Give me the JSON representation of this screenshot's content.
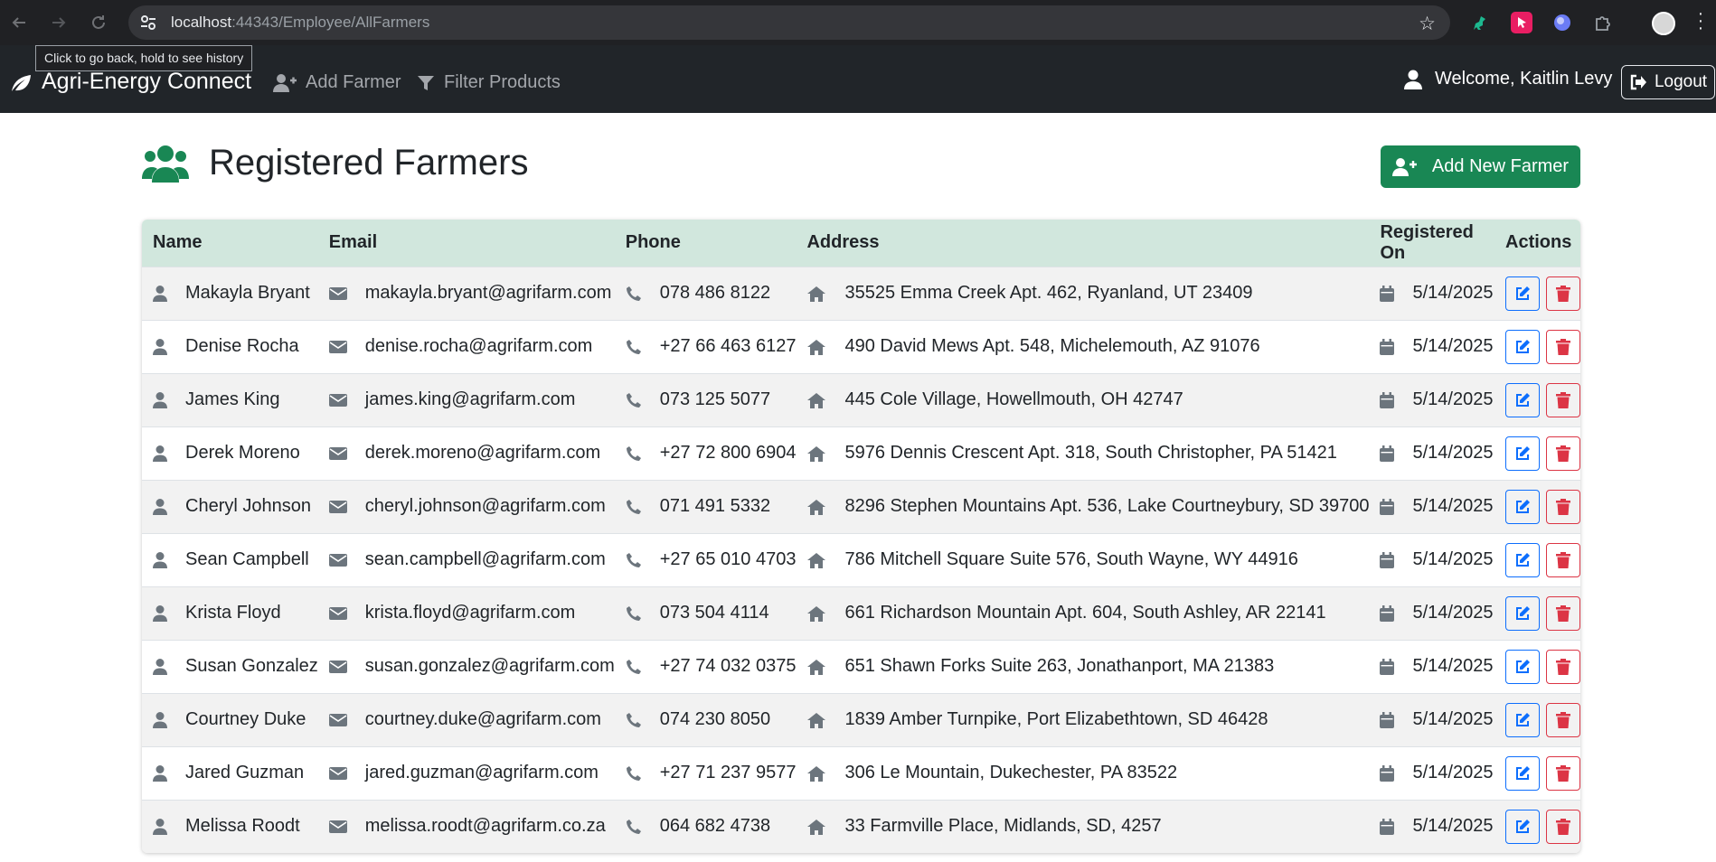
{
  "browser": {
    "url_host": "localhost",
    "url_path": ":44343/Employee/AllFarmers",
    "tooltip": "Click to go back, hold to see history"
  },
  "navbar": {
    "brand": "Agri-Energy Connect",
    "links": [
      "Add Farmer",
      "Filter Products"
    ],
    "welcome": "Welcome, Kaitlin Levy",
    "logout": "Logout"
  },
  "page": {
    "title": "Registered Farmers",
    "add_button": "Add New Farmer"
  },
  "table": {
    "headers": [
      "Name",
      "Email",
      "Phone",
      "Address",
      "Registered On",
      "Actions"
    ],
    "rows": [
      {
        "name": "Makayla Bryant",
        "email": "makayla.bryant@agrifarm.com",
        "phone": "078 486 8122",
        "address": "35525 Emma Creek Apt. 462, Ryanland, UT 23409",
        "registered": "5/14/2025"
      },
      {
        "name": "Denise Rocha",
        "email": "denise.rocha@agrifarm.com",
        "phone": "+27 66 463 6127",
        "address": "490 David Mews Apt. 548, Michelemouth, AZ 91076",
        "registered": "5/14/2025"
      },
      {
        "name": "James King",
        "email": "james.king@agrifarm.com",
        "phone": "073 125 5077",
        "address": "445 Cole Village, Howellmouth, OH 42747",
        "registered": "5/14/2025"
      },
      {
        "name": "Derek Moreno",
        "email": "derek.moreno@agrifarm.com",
        "phone": "+27 72 800 6904",
        "address": "5976 Dennis Crescent Apt. 318, South Christopher, PA 51421",
        "registered": "5/14/2025"
      },
      {
        "name": "Cheryl Johnson",
        "email": "cheryl.johnson@agrifarm.com",
        "phone": "071 491 5332",
        "address": "8296 Stephen Mountains Apt. 536, Lake Courtneybury, SD 39700",
        "registered": "5/14/2025"
      },
      {
        "name": "Sean Campbell",
        "email": "sean.campbell@agrifarm.com",
        "phone": "+27 65 010 4703",
        "address": "786 Mitchell Square Suite 576, South Wayne, WY 44916",
        "registered": "5/14/2025"
      },
      {
        "name": "Krista Floyd",
        "email": "krista.floyd@agrifarm.com",
        "phone": "073 504 4114",
        "address": "661 Richardson Mountain Apt. 604, South Ashley, AR 22141",
        "registered": "5/14/2025"
      },
      {
        "name": "Susan Gonzalez",
        "email": "susan.gonzalez@agrifarm.com",
        "phone": "+27 74 032 0375",
        "address": "651 Shawn Forks Suite 263, Jonathanport, MA 21383",
        "registered": "5/14/2025"
      },
      {
        "name": "Courtney Duke",
        "email": "courtney.duke@agrifarm.com",
        "phone": "074 230 8050",
        "address": "1839 Amber Turnpike, Port Elizabethtown, SD 46428",
        "registered": "5/14/2025"
      },
      {
        "name": "Jared Guzman",
        "email": "jared.guzman@agrifarm.com",
        "phone": "+27 71 237 9577",
        "address": "306 Le Mountain, Dukechester, PA 83522",
        "registered": "5/14/2025"
      },
      {
        "name": "Melissa Roodt",
        "email": "melissa.roodt@agrifarm.co.za",
        "phone": "064 682 4738",
        "address": "33 Farmville Place, Midlands, SD, 4257",
        "registered": "5/14/2025"
      }
    ]
  },
  "colors": {
    "navbar_bg": "#212529",
    "brand_green": "#198754",
    "table_header_bg": "#d1e7dd",
    "edit_blue": "#0d6efd",
    "delete_red": "#dc3545",
    "icon_gray": "#6c757d"
  },
  "icons": {
    "row": [
      "user-icon",
      "envelope-icon",
      "phone-icon",
      "home-icon",
      "calendar-icon"
    ],
    "actions": [
      "edit-icon",
      "trash-icon"
    ]
  }
}
